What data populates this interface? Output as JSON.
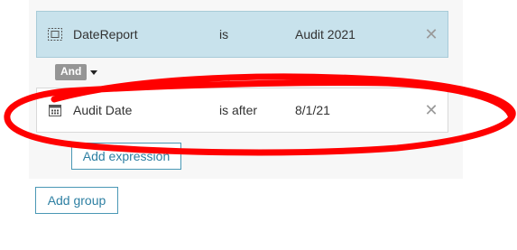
{
  "expressions": [
    {
      "icon": "date-report-field-icon",
      "field": "DateReport",
      "operator": "is",
      "value": "Audit 2021",
      "remove": "✕"
    },
    {
      "icon": "calendar-icon",
      "field": "Audit Date",
      "operator": "is after",
      "value": "8/1/21",
      "remove": "✕"
    }
  ],
  "connector": {
    "label": "And"
  },
  "buttons": {
    "add_expression": "Add expression",
    "add_group": "Add group"
  },
  "colors": {
    "selected_row": "#c8e2ec",
    "accent": "#2d7fa2",
    "annotation": "#ff0000"
  }
}
